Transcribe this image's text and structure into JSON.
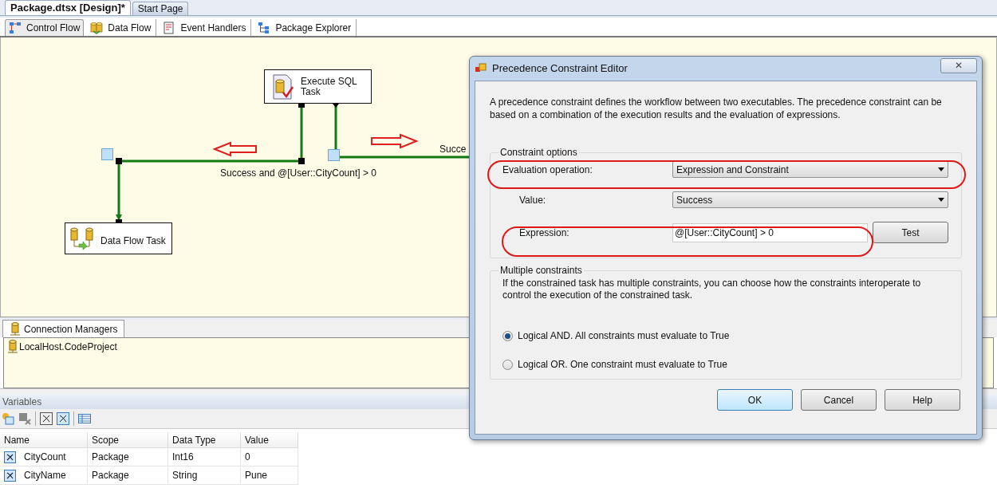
{
  "document_tabs": [
    {
      "label": "Package.dtsx [Design]*",
      "selected": true
    },
    {
      "label": "Start Page",
      "selected": false
    }
  ],
  "designer_tabs": [
    {
      "label": "Control Flow",
      "kind": "flow",
      "selected": true
    },
    {
      "label": "Data Flow",
      "kind": "data",
      "selected": false
    },
    {
      "label": "Event Handlers",
      "kind": "events",
      "selected": false
    },
    {
      "label": "Package Explorer",
      "kind": "explorer",
      "selected": false
    }
  ],
  "canvas": {
    "tasks": [
      {
        "label": "Execute SQL Task",
        "kind": "sql"
      },
      {
        "label": "Data Flow Task",
        "kind": "dataflow"
      }
    ],
    "constraint_labels": [
      "Success and @[User::CityCount] > 0",
      "Succe"
    ]
  },
  "connection_managers": {
    "tab": "Connection Managers",
    "items": [
      "LocalHost.CodeProject"
    ]
  },
  "variables": {
    "title": "Variables",
    "columns": [
      "Name",
      "Scope",
      "Data Type",
      "Value"
    ],
    "rows": [
      [
        "CityCount",
        "Package",
        "Int16",
        "0"
      ],
      [
        "CityName",
        "Package",
        "String",
        "Pune"
      ]
    ]
  },
  "dialog": {
    "title": "Precedence Constraint Editor",
    "close": "✕",
    "description": "A precedence constraint defines the workflow between two executables. The precedence constraint can be based on a combination of the execution results and the evaluation of expressions.",
    "constraint_options": {
      "legend": "Constraint options",
      "evaluation_operation": {
        "label": "Evaluation operation:",
        "value": "Expression and Constraint"
      },
      "value": {
        "label": "Value:",
        "value": "Success"
      },
      "expression": {
        "label": "Expression:",
        "value": "@[User::CityCount] > 0"
      },
      "test_button": "Test"
    },
    "multiple_constraints": {
      "legend": "Multiple constraints",
      "description": "If the constrained task has multiple constraints, you can choose how the constraints interoperate to control the execution of the constrained task.",
      "options": [
        {
          "label": "Logical AND. All constraints must evaluate to True",
          "selected": true
        },
        {
          "label": "Logical OR. One constraint must evaluate to True",
          "selected": false
        }
      ]
    },
    "buttons": [
      {
        "label": "OK",
        "default": true
      },
      {
        "label": "Cancel",
        "default": false
      },
      {
        "label": "Help",
        "default": false
      }
    ]
  }
}
